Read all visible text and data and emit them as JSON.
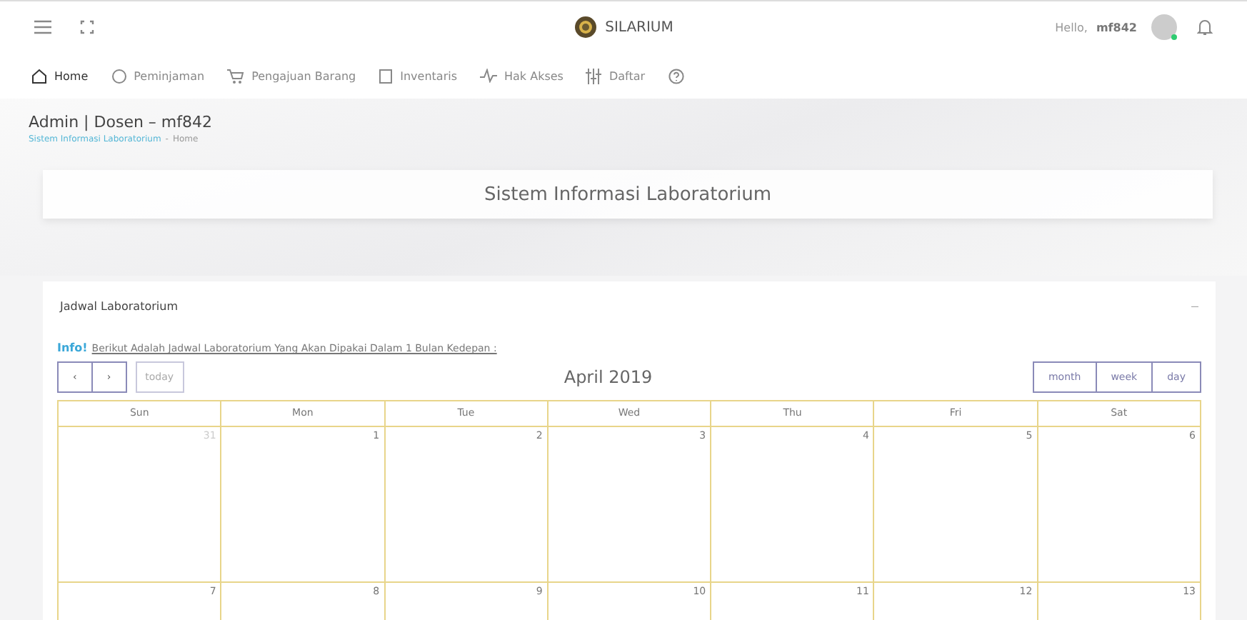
{
  "topbar": {
    "brand": "SILARIUM",
    "greeting": "Hello,",
    "username": "mf842"
  },
  "nav": [
    {
      "label": "Home",
      "kind": "home",
      "selected": true
    },
    {
      "label": "Peminjaman",
      "kind": "coin",
      "selected": false
    },
    {
      "label": "Pengajuan Barang",
      "kind": "cart",
      "selected": false
    },
    {
      "label": "Inventaris",
      "kind": "clipboard",
      "selected": false
    },
    {
      "label": "Hak Akses",
      "kind": "pulse",
      "selected": false
    },
    {
      "label": "Daftar",
      "kind": "sliders",
      "selected": false
    },
    {
      "kind": "help",
      "selected": false
    }
  ],
  "header": {
    "title": "Admin | Dosen – mf842",
    "breadcrumb_link": "Sistem Informasi Laboratorium",
    "breadcrumb_sep": "-",
    "breadcrumb_current": "Home",
    "banner": "Sistem Informasi Laboratorium"
  },
  "card": {
    "title": "Jadwal Laboratorium",
    "collapse": "–",
    "info_label": "Info!",
    "info_text": "Berikut Adalah Jadwal Laboratorium Yang Akan Dipakai Dalam 1 Bulan Kedepan :",
    "calendar": {
      "prev": "‹",
      "next": "›",
      "today": "today",
      "title": "April 2019",
      "views": [
        {
          "label": "month",
          "selected": false
        },
        {
          "label": "week",
          "selected": false
        },
        {
          "label": "day",
          "selected": false
        }
      ],
      "weekdays": [
        "Sun",
        "Mon",
        "Tue",
        "Wed",
        "Thu",
        "Fri",
        "Sat"
      ],
      "weeks": [
        [
          {
            "day": "31",
            "other_month": true
          },
          {
            "day": "1",
            "other_month": false
          },
          {
            "day": "2",
            "other_month": false
          },
          {
            "day": "3",
            "other_month": false
          },
          {
            "day": "4",
            "other_month": false
          },
          {
            "day": "5",
            "other_month": false
          },
          {
            "day": "6",
            "other_month": false
          }
        ],
        [
          {
            "day": "7",
            "other_month": false
          },
          {
            "day": "8",
            "other_month": false
          },
          {
            "day": "9",
            "other_month": false
          },
          {
            "day": "10",
            "other_month": false
          },
          {
            "day": "11",
            "other_month": false
          },
          {
            "day": "12",
            "other_month": false
          },
          {
            "day": "13",
            "other_month": false
          }
        ]
      ]
    }
  }
}
